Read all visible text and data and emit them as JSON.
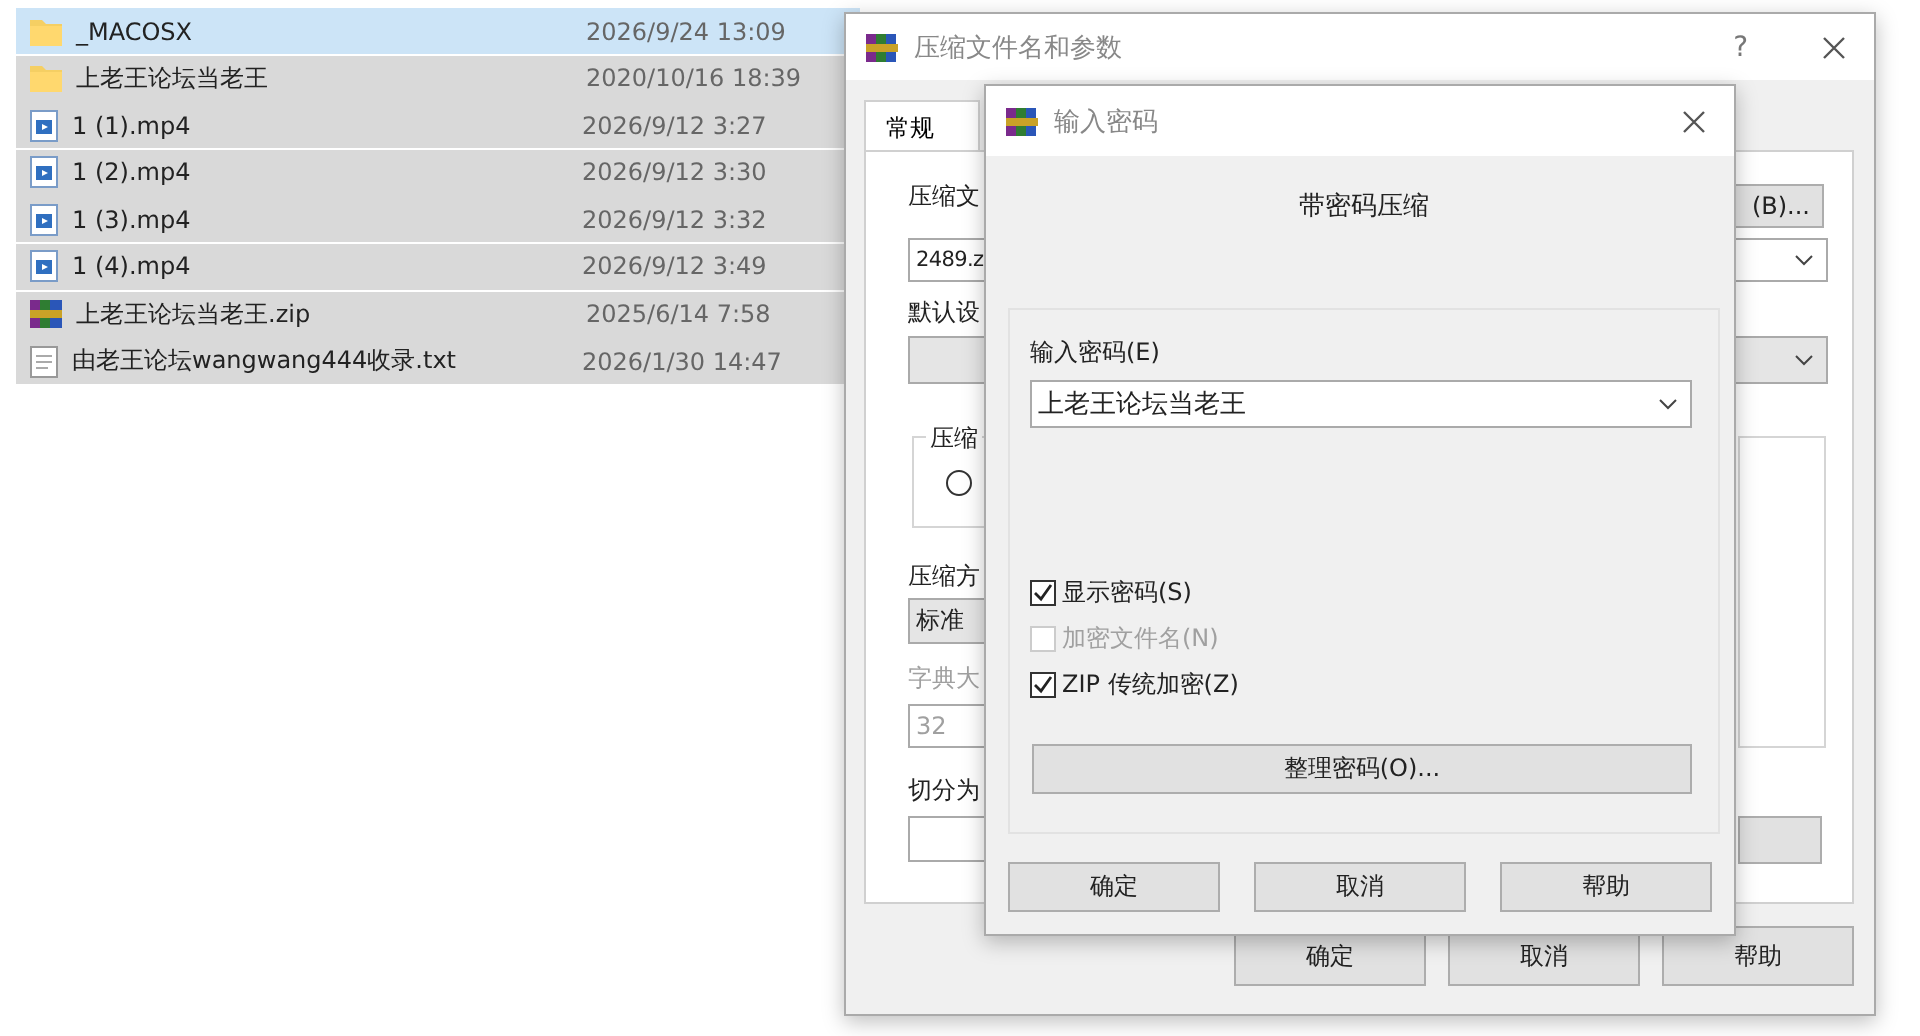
{
  "files": [
    {
      "name": "_MACOSX",
      "date": "2026/9/24 13:09",
      "kind": "folder",
      "selected": true,
      "hovered": true
    },
    {
      "name": "上老王论坛当老王",
      "date": "2020/10/16 18:39",
      "kind": "folder",
      "selected": true,
      "hovered": false
    },
    {
      "name": "1 (1).mp4",
      "date": "2026/9/12 3:27",
      "kind": "video",
      "selected": true,
      "hovered": false
    },
    {
      "name": "1 (2).mp4",
      "date": "2026/9/12 3:30",
      "kind": "video",
      "selected": true,
      "hovered": false
    },
    {
      "name": "1 (3).mp4",
      "date": "2026/9/12 3:32",
      "kind": "video",
      "selected": true,
      "hovered": false
    },
    {
      "name": "1 (4).mp4",
      "date": "2026/9/12 3:49",
      "kind": "video",
      "selected": true,
      "hovered": false
    },
    {
      "name": "上老王论坛当老王.zip",
      "date": "2025/6/14 7:58",
      "kind": "archive",
      "selected": true,
      "hovered": false
    },
    {
      "name": "由老王论坛wangwang444收录.txt",
      "date": "2026/1/30 14:47",
      "kind": "text",
      "selected": true,
      "hovered": false
    }
  ],
  "archive_dialog": {
    "title": "压缩文件名和参数",
    "help": "?",
    "tabs": [
      {
        "label": "常规",
        "selected": true
      }
    ],
    "archive_name_label": "压缩文",
    "browse_button": "(B)...",
    "archive_name": "2489.z",
    "profile_label": "默认设",
    "group_label": "压缩",
    "radio": {
      "selected": false
    },
    "method_label": "压缩方",
    "method": "标准",
    "dictionary_label": "字典大",
    "dictionary": "32",
    "dictionary_disabled": true,
    "split_label": "切分为",
    "buttons": [
      "确定",
      "取消",
      "帮助"
    ]
  },
  "password_dialog": {
    "title": "输入密码",
    "heading": "带密码压缩",
    "password_label": "输入密码(E)",
    "password": "上老王论坛当老王",
    "options": [
      {
        "label": "显示密码(S)",
        "checked": true,
        "disabled": false
      },
      {
        "label": "加密文件名(N)",
        "checked": false,
        "disabled": true
      },
      {
        "label": "ZIP 传统加密(Z)",
        "checked": true,
        "disabled": false
      }
    ],
    "organize_button": "整理密码(O)...",
    "buttons": [
      "确定",
      "取消",
      "帮助"
    ]
  }
}
